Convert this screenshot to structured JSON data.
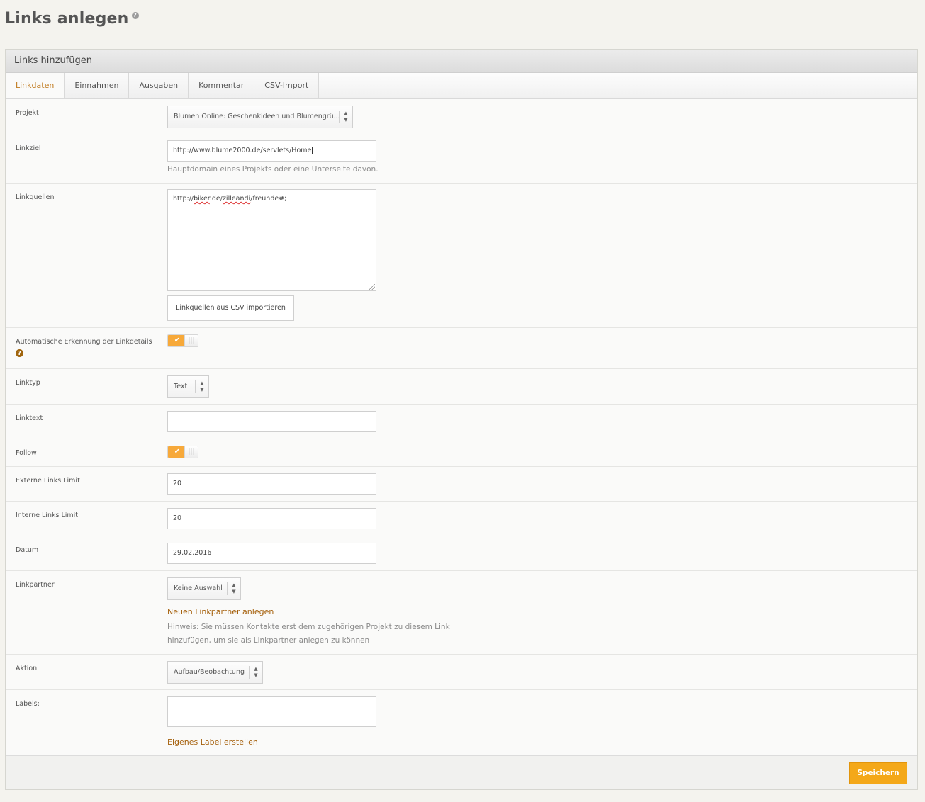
{
  "page": {
    "title": "Links anlegen",
    "help_icon": "question-icon"
  },
  "panel": {
    "title": "Links hinzufügen",
    "tabs": [
      {
        "label": "Linkdaten",
        "active": true
      },
      {
        "label": "Einnahmen",
        "active": false
      },
      {
        "label": "Ausgaben",
        "active": false
      },
      {
        "label": "Kommentar",
        "active": false
      },
      {
        "label": "CSV-Import",
        "active": false
      }
    ]
  },
  "form": {
    "projekt": {
      "label": "Projekt",
      "value": "Blumen Online: Geschenkideen und Blumengrü..."
    },
    "linkziel": {
      "label": "Linkziel",
      "value": "http://www.blume2000.de/servlets/Home",
      "hint": "Hauptdomain eines Projekts oder eine Unterseite davon."
    },
    "linkquellen": {
      "label": "Linkquellen",
      "value_prefix": "http://",
      "value_misspelled_1": "biker",
      "value_mid": ".de/",
      "value_misspelled_2": "zilleandi",
      "value_suffix": "/freunde#;",
      "import_button": "Linkquellen aus CSV importieren"
    },
    "auto_detect": {
      "label": "Automatische Erkennung der Linkdetails",
      "enabled": true
    },
    "linktyp": {
      "label": "Linktyp",
      "value": "Text"
    },
    "linktext": {
      "label": "Linktext",
      "value": ""
    },
    "follow": {
      "label": "Follow",
      "enabled": true
    },
    "externe_links_limit": {
      "label": "Externe Links Limit",
      "value": "20"
    },
    "interne_links_limit": {
      "label": "Interne Links Limit",
      "value": "20"
    },
    "datum": {
      "label": "Datum",
      "value": "29.02.2016"
    },
    "linkpartner": {
      "label": "Linkpartner",
      "value": "Keine Auswahl",
      "new_link": "Neuen Linkpartner anlegen",
      "hint_line1": "Hinweis: Sie müssen Kontakte erst dem zugehörigen Projekt zu diesem Link",
      "hint_line2": "hinzufügen, um sie als Linkpartner anlegen zu können"
    },
    "aktion": {
      "label": "Aktion",
      "value": "Aufbau/Beobachtung"
    },
    "labels": {
      "label": "Labels:",
      "value": "",
      "create_link": "Eigenes Label erstellen"
    }
  },
  "footer": {
    "save_button": "Speichern"
  },
  "colors": {
    "accent": "#f4a819",
    "link": "#a5600c",
    "active_tab": "#c07a1e",
    "toggle_on": "#f7a93a"
  }
}
